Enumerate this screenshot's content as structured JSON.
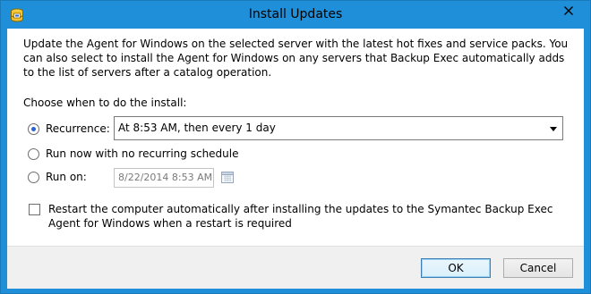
{
  "window": {
    "title": "Install Updates",
    "icon": "backup-exec-app-icon",
    "close_icon": "close-icon",
    "accent_color": "#1e8fd8"
  },
  "content": {
    "description": "Update the Agent for Windows on the selected server with the latest hot fixes and service packs. You can also select to install the Agent for Windows on any servers that Backup Exec automatically adds to the list of servers after a catalog operation.",
    "section_label": "Choose when to do the install:",
    "options": [
      {
        "label": "Recurrence:",
        "selected": true
      },
      {
        "label": "Run now with no recurring schedule",
        "selected": false
      },
      {
        "label": "Run on:",
        "selected": false
      }
    ],
    "recurrence_value": "At 8:53 AM, then every 1 day",
    "run_on_date": "8/22/2014 8:53 AM",
    "restart_checkbox": {
      "label": "Restart the computer automatically after installing the updates to the Symantec Backup Exec Agent for Windows when a restart is required",
      "checked": false
    }
  },
  "footer": {
    "ok_label": "OK",
    "cancel_label": "Cancel"
  }
}
